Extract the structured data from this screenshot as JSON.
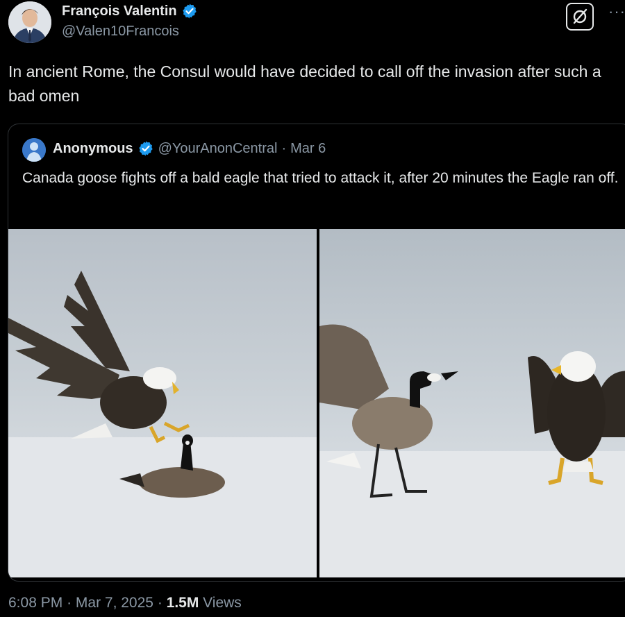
{
  "author": {
    "display_name": "François Valentin",
    "handle": "@Valen10Francois"
  },
  "icons": {
    "verified": "verified-badge-icon",
    "grok": "grok-icon",
    "more": "more-icon"
  },
  "tweet": {
    "text": "In ancient Rome, the Consul would have decided to call off the invasion after such a bad omen",
    "time": "6:08 PM",
    "date": "Mar 7, 2025",
    "views_count": "1.5M",
    "views_label": "Views"
  },
  "quote": {
    "display_name": "Anonymous",
    "handle": "@YourAnonCentral",
    "date": "Mar 6",
    "text": "Canada goose fights off a bald eagle that tried to attack it, after 20 minutes the Eagle ran off."
  },
  "colors": {
    "background": "#000000",
    "text": "#e7e9ea",
    "secondary": "#8b98a5",
    "verified": "#1d9bf0",
    "border": "#2f3336"
  }
}
